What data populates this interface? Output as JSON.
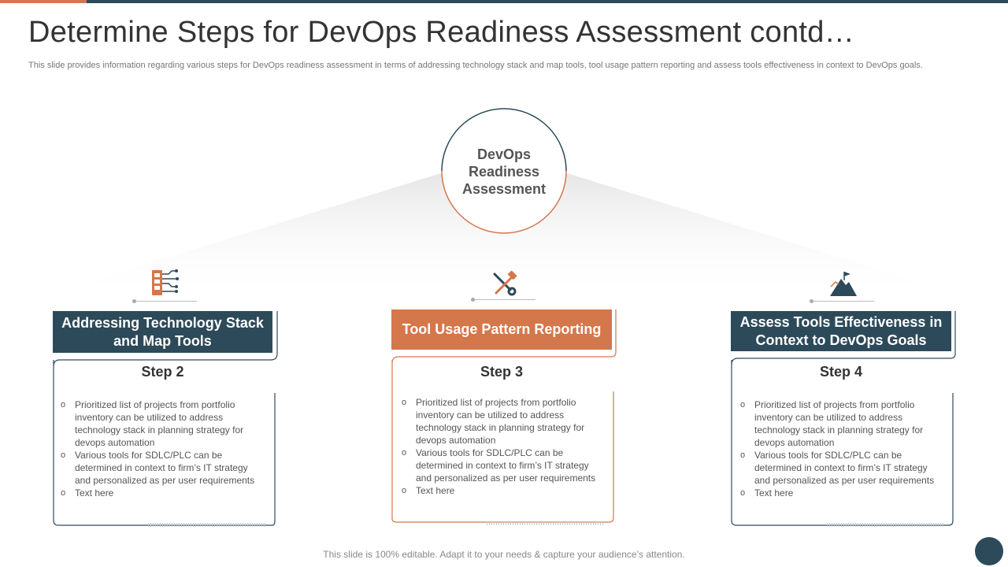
{
  "slide": {
    "title": "Determine Steps for DevOps Readiness Assessment contd…",
    "subtitle": "This slide provides information regarding various steps for DevOps readiness assessment in terms of addressing technology stack and map tools, tool usage pattern reporting and assess tools effectiveness in context to DevOps goals.",
    "center": "DevOps Readiness Assessment",
    "footer": "This slide is 100% editable. Adapt it to your needs & capture your audience’s attention."
  },
  "colors": {
    "dark": "#2d4a5a",
    "accent": "#d4774b"
  },
  "cards": [
    {
      "heading": "Addressing Technology Stack and Map Tools",
      "step": "Step 2",
      "icon": "circuit-board-icon",
      "bullets": [
        "Prioritized list of projects from portfolio inventory can be utilized to address technology stack in planning strategy for devops automation",
        "Various tools for SDLC/PLC can be determined in context to firm’s IT strategy and personalized as per user requirements",
        "Text here"
      ]
    },
    {
      "heading": "Tool Usage Pattern Reporting",
      "step": "Step 3",
      "icon": "wrench-hammer-icon",
      "bullets": [
        "Prioritized list of projects from portfolio inventory can be utilized to address technology stack in planning strategy for devops automation",
        "Various tools for SDLC/PLC can be determined in context to firm’s IT strategy and personalized as per user requirements",
        "Text here"
      ]
    },
    {
      "heading": "Assess Tools Effectiveness in Context to DevOps Goals",
      "step": "Step 4",
      "icon": "mountain-flag-icon",
      "bullets": [
        "Prioritized list of projects from portfolio inventory can be utilized to address technology stack in planning strategy for devops automation",
        "Various tools for SDLC/PLC can be determined in context to firm’s IT strategy and personalized as per user requirements",
        "Text here"
      ]
    }
  ]
}
